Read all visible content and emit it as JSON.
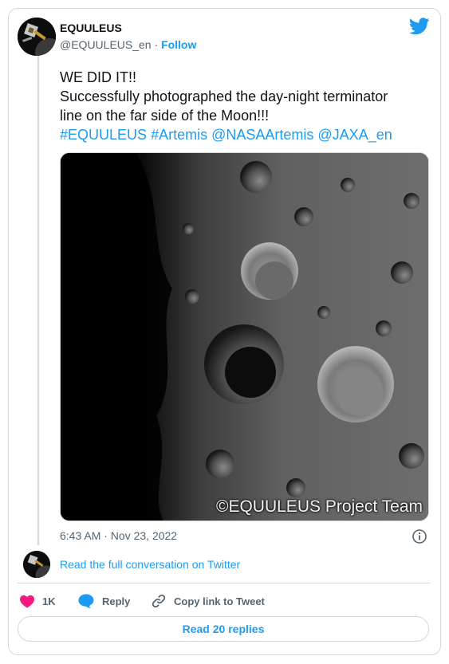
{
  "author": {
    "display_name": "EQUULEUS",
    "handle": "@EQUULEUS_en",
    "separator": " · ",
    "follow_label": "Follow",
    "avatar_icon": "spacecraft-avatar"
  },
  "brand": {
    "logo_icon": "twitter-bird-icon",
    "accent_color": "#1d9bf0"
  },
  "tweet": {
    "line1": "WE DID IT!!",
    "line2": "Successfully photographed the day-night terminator",
    "line3": "line on the far side of the Moon!!!",
    "hashtag1": "#EQUULEUS",
    "hashtag2": "#Artemis",
    "mention1": "@NASAArtemis",
    "mention2": "@JAXA_en"
  },
  "media": {
    "subject": "Moon far side terminator photo",
    "watermark": "©EQUULEUS Project Team"
  },
  "timestamp": "6:43 AM · Nov 23, 2022",
  "conversation_link": "Read the full conversation on Twitter",
  "actions": {
    "like_count": "1K",
    "reply_label": "Reply",
    "copy_label": "Copy link to Tweet",
    "like_color": "#f91880"
  },
  "read_replies_label": "Read 20 replies"
}
